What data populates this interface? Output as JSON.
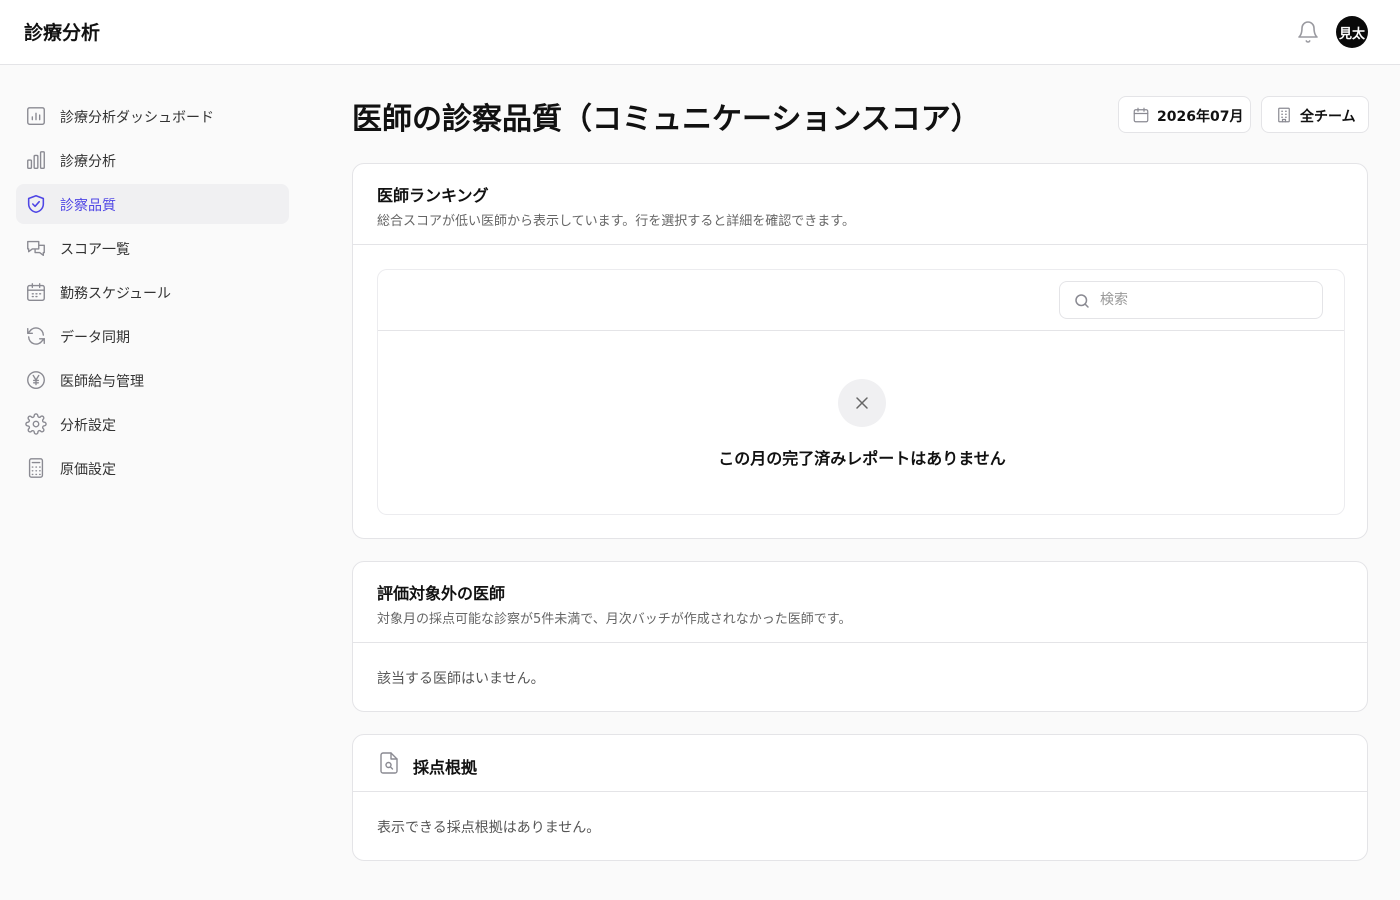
{
  "header": {
    "app_title": "診療分析",
    "avatar_initials": "見太"
  },
  "sidebar": {
    "items": [
      {
        "label": "診療分析ダッシュボード",
        "icon": "chart-icon",
        "active": false
      },
      {
        "label": "診療分析",
        "icon": "bar-chart-icon",
        "active": false
      },
      {
        "label": "診察品質",
        "icon": "shield-check-icon",
        "active": true
      },
      {
        "label": "スコア一覧",
        "icon": "messages-icon",
        "active": false
      },
      {
        "label": "勤務スケジュール",
        "icon": "calendar-icon",
        "active": false
      },
      {
        "label": "データ同期",
        "icon": "refresh-icon",
        "active": false
      },
      {
        "label": "医師給与管理",
        "icon": "yen-icon",
        "active": false
      },
      {
        "label": "分析設定",
        "icon": "gear-icon",
        "active": false
      },
      {
        "label": "原価設定",
        "icon": "calculator-icon",
        "active": false
      }
    ]
  },
  "main": {
    "title": "医師の診察品質（コミュニケーションスコア）",
    "month_label": "2026年07月",
    "team_label": "全チーム",
    "ranking": {
      "title": "医師ランキング",
      "subtitle": "総合スコアが低い医師から表示しています。行を選択すると詳細を確認できます。",
      "search_placeholder": "検索",
      "empty_message": "この月の完了済みレポートはありません"
    },
    "excluded": {
      "title": "評価対象外の医師",
      "subtitle": "対象月の採点可能な診察が5件未満で、月次バッチが作成されなかった医師です。",
      "empty_message": "該当する医師はいません。"
    },
    "rationale": {
      "title": "採点根拠",
      "empty_message": "表示できる採点根拠はありません。"
    }
  },
  "colors": {
    "accent": "#4f46e5",
    "active_bg": "#f0f0f2",
    "border": "#e4e4e7"
  }
}
